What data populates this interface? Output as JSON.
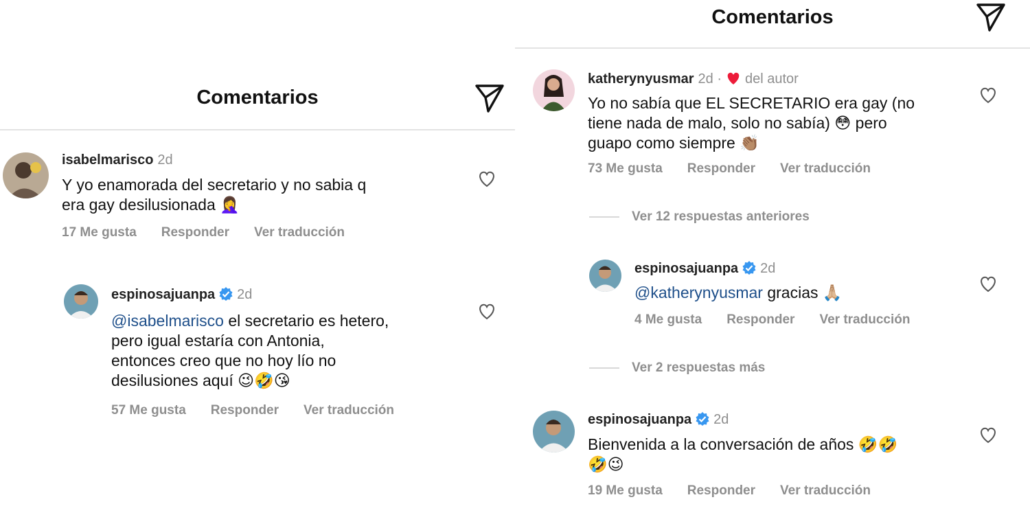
{
  "header": {
    "title": "Comentarios"
  },
  "left": {
    "comment": {
      "username": "isabelmarisco",
      "time": "2d",
      "lines": [
        "Y yo enamorada del secretario y no sabia q",
        "era gay  desilusionada 🤦‍♀️"
      ],
      "likes": "17 Me gusta",
      "reply": "Responder",
      "translate": "Ver traducción"
    },
    "reply": {
      "username": "espinosajuanpa",
      "time": "2d",
      "mention": "@isabelmarisco",
      "line1_rest": " el secretario es hetero,",
      "lines": [
        "pero igual estaría con Antonia,",
        "entonces creo que no hoy lío no",
        "desilusiones aquí 😉🤣😘"
      ],
      "likes": "57 Me gusta",
      "reply": "Responder",
      "translate": "Ver traducción"
    }
  },
  "right": {
    "comment": {
      "username": "katherynyusmar",
      "time": "2d ·",
      "author_label": "del autor",
      "lines": [
        "Yo no sabía que EL SECRETARIO era gay (no",
        "tiene nada de malo, solo no sabía) 😳 pero",
        "guapo como siempre 👏🏽"
      ],
      "likes": "73 Me gusta",
      "reply": "Responder",
      "translate": "Ver traducción"
    },
    "view_previous": "Ver 12 respuestas anteriores",
    "reply1": {
      "username": "espinosajuanpa",
      "time": "2d",
      "mention": "@katherynyusmar",
      "rest": " gracias 🙏🏼",
      "likes": "4 Me gusta",
      "reply": "Responder",
      "translate": "Ver traducción"
    },
    "view_more": "Ver 2 respuestas más",
    "reply2": {
      "username": "espinosajuanpa",
      "time": "2d",
      "lines": [
        "Bienvenida a la conversación de años 🤣🤣",
        "🤣😉"
      ],
      "likes": "19 Me gusta",
      "reply": "Responder",
      "translate": "Ver traducción"
    }
  },
  "colors": {
    "verified": "#3897f0",
    "heart_red": "#ed1c3a",
    "mention": "#1e4f8a",
    "muted": "#8e8e8e"
  },
  "icons": {
    "send": "send-icon",
    "like": "heart-icon",
    "verified": "verified-badge-icon"
  }
}
